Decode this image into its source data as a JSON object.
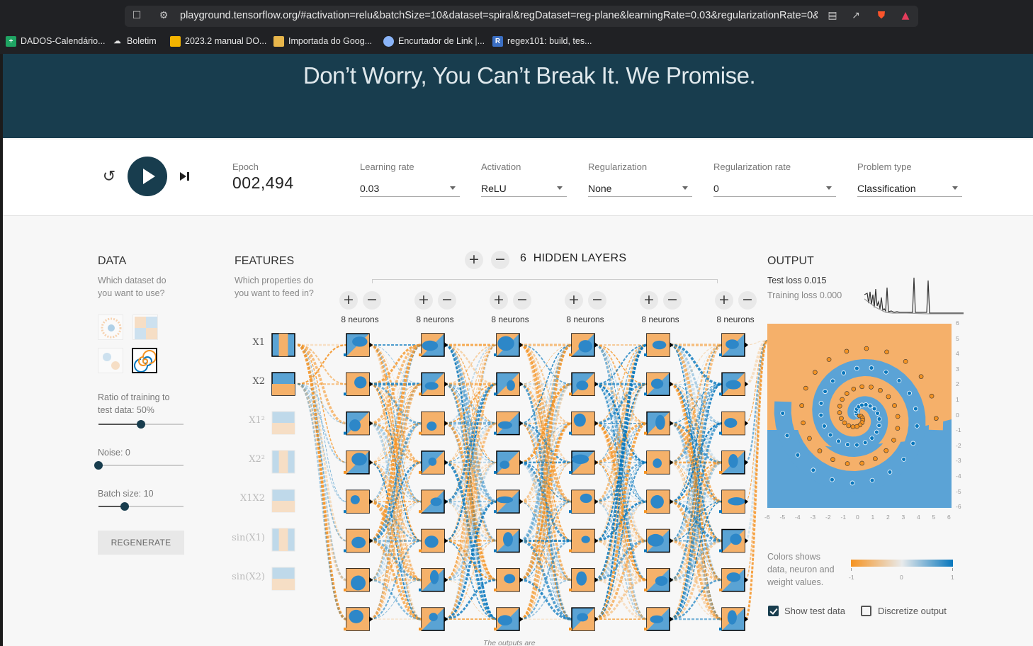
{
  "browser": {
    "url": "playground.tensorflow.org/#activation=relu&batchSize=10&dataset=spiral&regDataset=reg-plane&learningRate=0.03&regularizationRate=0&...",
    "bookmarks": [
      "DADOS-Calendário...",
      "Boletim",
      "2023.2 manual DO...",
      "Importada do Goog...",
      "Encurtador de Link |...",
      "regex101: build, tes..."
    ]
  },
  "hero": {
    "title": "Don’t Worry, You Can’t Break It. We Promise."
  },
  "controls": {
    "epoch_label": "Epoch",
    "epoch_value": "002,494",
    "learning_rate": {
      "label": "Learning rate",
      "value": "0.03"
    },
    "activation": {
      "label": "Activation",
      "value": "ReLU"
    },
    "regularization": {
      "label": "Regularization",
      "value": "None"
    },
    "regularization_rate": {
      "label": "Regularization rate",
      "value": "0"
    },
    "problem_type": {
      "label": "Problem type",
      "value": "Classification"
    }
  },
  "data_panel": {
    "title": "DATA",
    "subtitle_1": "Which dataset do",
    "subtitle_2": "you want to use?",
    "ratio_label_1": "Ratio of training to",
    "ratio_label_2": "test data:  50%",
    "ratio_percent": 50,
    "noise_label": "Noise:  0",
    "noise_value": 0,
    "batch_label": "Batch size:  10",
    "batch_value": 10,
    "regenerate": "REGENERATE"
  },
  "features_panel": {
    "title": "FEATURES",
    "subtitle_1": "Which properties do",
    "subtitle_2": "you want to feed in?",
    "features": [
      {
        "name": "X1",
        "active": true
      },
      {
        "name": "X2",
        "active": true
      },
      {
        "name": "X1²",
        "active": false
      },
      {
        "name": "X2²",
        "active": false
      },
      {
        "name": "X1X2",
        "active": false
      },
      {
        "name": "sin(X1)",
        "active": false
      },
      {
        "name": "sin(X2)",
        "active": false
      }
    ]
  },
  "network": {
    "hidden_layers_count": "6",
    "hidden_layers_label": "HIDDEN LAYERS",
    "layer_neurons_label": "8 neurons",
    "layers": 6,
    "neurons_per_layer": 8,
    "note": "The outputs are"
  },
  "output_panel": {
    "title": "OUTPUT",
    "test_loss_label": "Test loss",
    "test_loss": "0.015",
    "training_loss_label": "Training loss",
    "training_loss": "0.000",
    "legend_1": "Colors shows",
    "legend_2": "data, neuron and",
    "legend_3": "weight values.",
    "scale_min": "-1",
    "scale_mid": "0",
    "scale_max": "1",
    "show_test_data": "Show test data",
    "show_test_data_checked": true,
    "discretize_output": "Discretize output",
    "discretize_checked": false,
    "axis_ticks": [
      "-6",
      "-5",
      "-4",
      "-3",
      "-2",
      "-1",
      "0",
      "1",
      "2",
      "3",
      "4",
      "5",
      "6"
    ]
  },
  "colors": {
    "orange": "#f59322",
    "blue": "#0877bd",
    "hero": "#183d4e"
  }
}
